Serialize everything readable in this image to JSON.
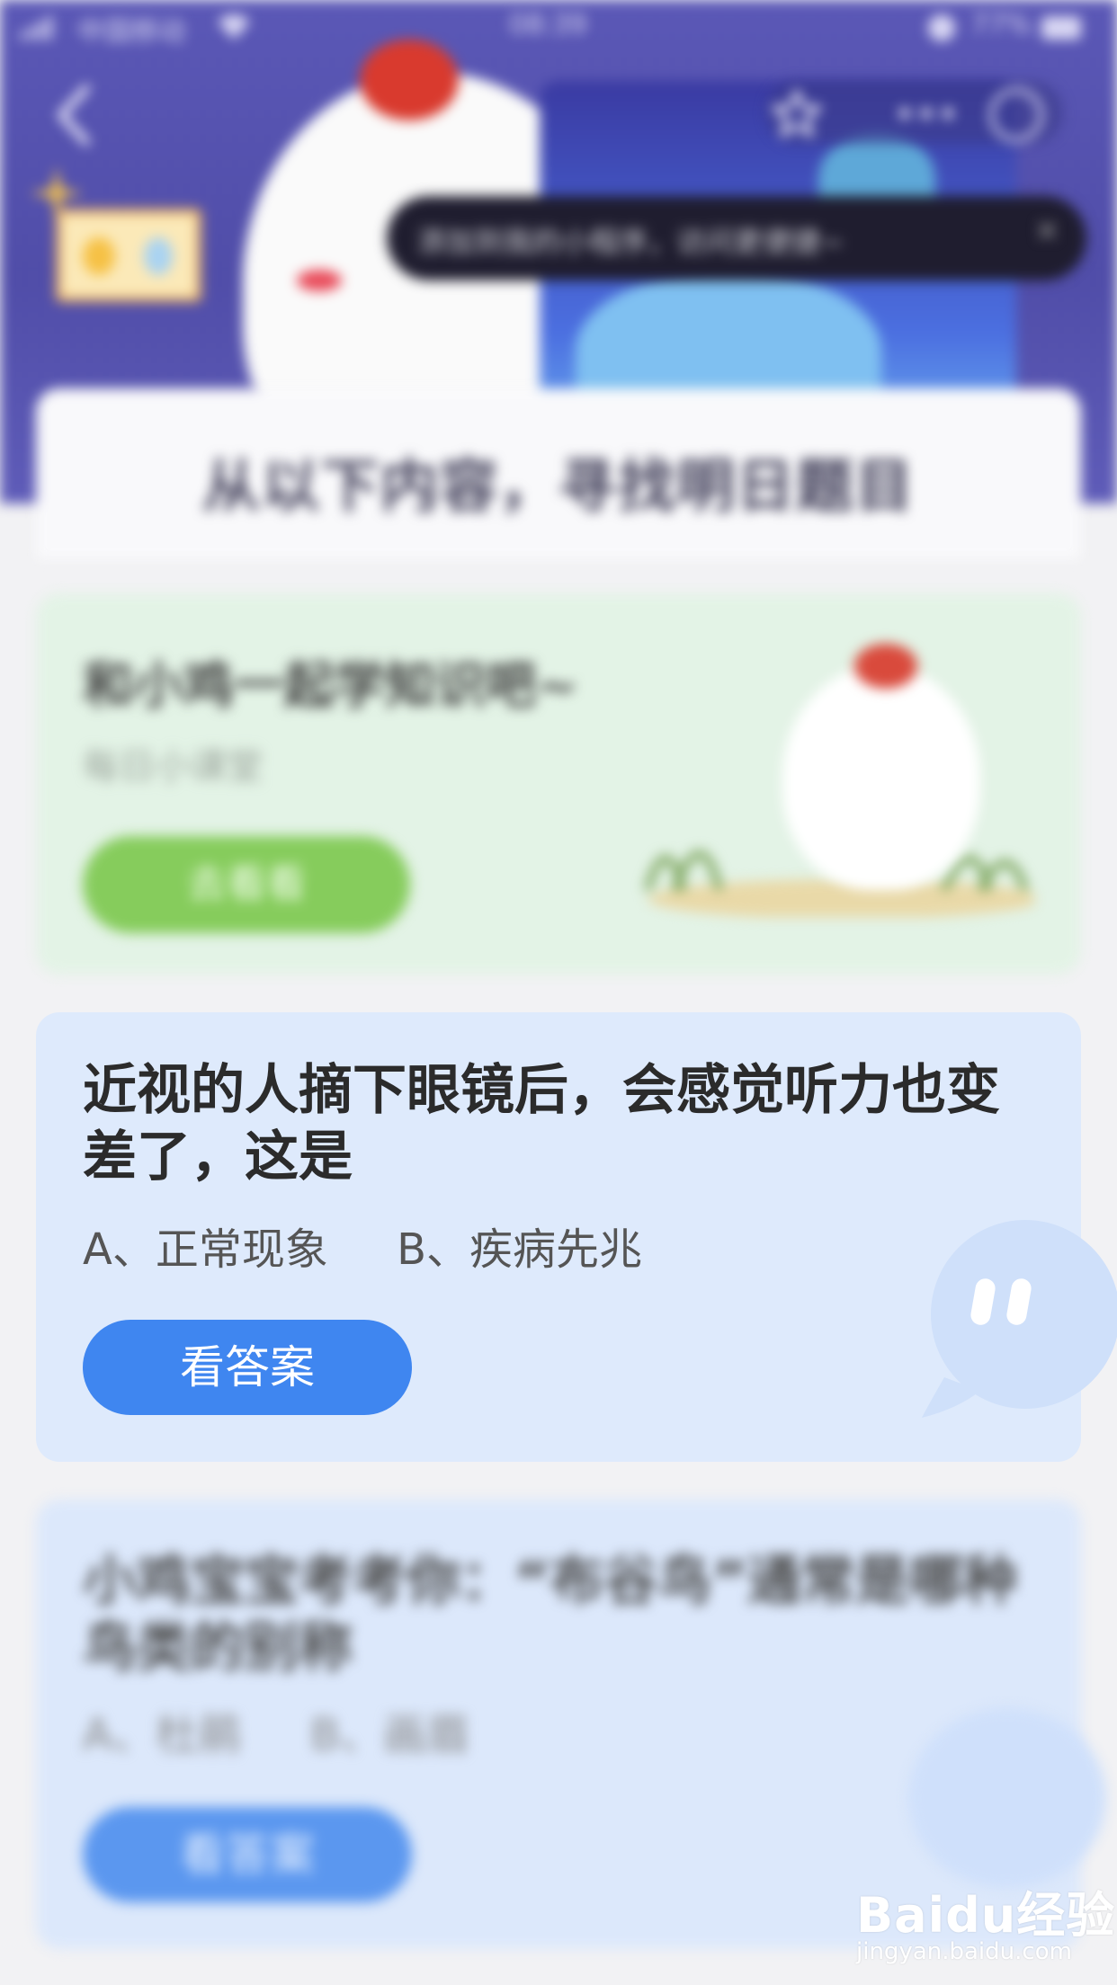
{
  "status_bar": {
    "carrier": "中国移动",
    "time": "08:39",
    "battery": "77%"
  },
  "header": {
    "tooltip_text": "添加到我的小程序，访问更便捷~",
    "tooltip_close": "×",
    "banner_title": "从以下内容，寻找明日题目"
  },
  "card_learn": {
    "title": "和小鸡一起学知识吧~",
    "subtitle": "每日小课堂",
    "button_label": "去看看"
  },
  "card_question": {
    "question": "近视的人摘下眼镜后，会感觉听力也变差了，这是",
    "options": "A、正常现象     B、疾病先兆",
    "button_label": "看答案"
  },
  "card_question_next": {
    "question": "小鸡宝宝考考你：“布谷鸟”通常是哪种鸟类的别称",
    "options": "A、杜鹃     B、画眉",
    "button_label": "看答案"
  },
  "watermark": {
    "logo": "Baidu经验",
    "url": "jingyan.baidu.com"
  },
  "icons": [
    "back-icon",
    "star-icon",
    "more-icon",
    "close-circle-icon",
    "lamp-icon",
    "bubble-icon"
  ],
  "colors": {
    "header_bg": "#5a57b6",
    "answer_button": "#3f86f0",
    "learn_button": "#86cc5c",
    "question_card_bg": "#deeafc"
  }
}
